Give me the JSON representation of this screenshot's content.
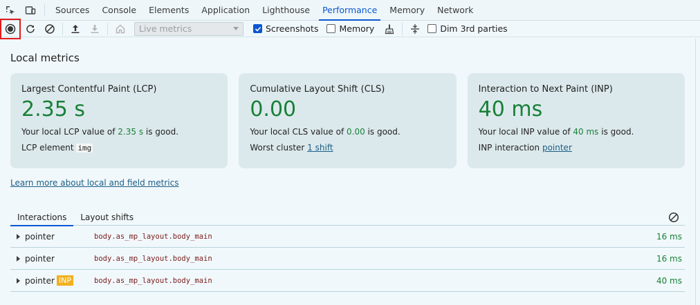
{
  "devtools": {
    "tabs": [
      "Sources",
      "Console",
      "Elements",
      "Application",
      "Lighthouse",
      "Performance",
      "Memory",
      "Network"
    ],
    "active_tab": "Performance",
    "left_icons": [
      "element-picker-icon",
      "device-toolbar-icon"
    ]
  },
  "toolbar": {
    "buttons": [
      "record-icon",
      "reload-icon",
      "clear-icon",
      "upload-icon",
      "download-icon",
      "home-icon"
    ],
    "select_value": "Live metrics",
    "screenshots_label": "Screenshots",
    "screenshots_checked": true,
    "memory_label": "Memory",
    "memory_checked": false,
    "gc_icon": "broom-icon",
    "dim_label": "Dim 3rd parties",
    "dim_checked": false
  },
  "local_metrics": {
    "title": "Local metrics",
    "cards": [
      {
        "title": "Largest Contentful Paint (LCP)",
        "value": "2.35 s",
        "desc_pre": "Your local LCP value of ",
        "desc_val": "2.35 s",
        "desc_post": " is good.",
        "detail_label": "LCP element",
        "detail_value": "img",
        "detail_is_link": false
      },
      {
        "title": "Cumulative Layout Shift (CLS)",
        "value": "0.00",
        "desc_pre": "Your local CLS value of ",
        "desc_val": "0.00",
        "desc_post": " is good.",
        "detail_label": "Worst cluster",
        "detail_value": "1 shift",
        "detail_is_link": true
      },
      {
        "title": "Interaction to Next Paint (INP)",
        "value": "40 ms",
        "desc_pre": "Your local INP value of ",
        "desc_val": "40 ms",
        "desc_post": " is good.",
        "detail_label": "INP interaction",
        "detail_value": "pointer",
        "detail_is_link": true
      }
    ],
    "learn_more": "Learn more about local and field metrics"
  },
  "interactions": {
    "tabs": [
      "Interactions",
      "Layout shifts"
    ],
    "active": "Interactions",
    "rows": [
      {
        "type": "pointer",
        "badge": "",
        "node": "body.as_mp_layout.body_main",
        "duration": "16 ms"
      },
      {
        "type": "pointer",
        "badge": "",
        "node": "body.as_mp_layout.body_main",
        "duration": "16 ms"
      },
      {
        "type": "pointer",
        "badge": "INP",
        "node": "body.as_mp_layout.body_main",
        "duration": "40 ms"
      }
    ]
  }
}
